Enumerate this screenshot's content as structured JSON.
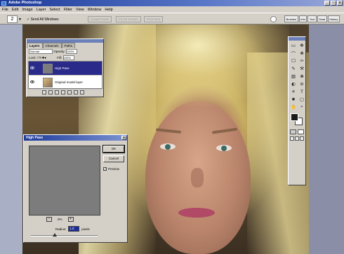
{
  "window": {
    "title": "Adobe Photoshop",
    "controls": [
      "_",
      "□",
      "x"
    ]
  },
  "menubar": [
    "File",
    "Edit",
    "Image",
    "Layer",
    "Select",
    "Filter",
    "View",
    "Window",
    "Help"
  ],
  "options": {
    "tool_preset": "2",
    "auto_select_label": "✓ Send All Windows",
    "buttons": [
      "Actual Pixels",
      "Fit On Screen",
      "Print Size"
    ],
    "palette_tabs": [
      "Brushes",
      "Info",
      "Tool",
      "Swat",
      "History"
    ]
  },
  "layers_palette": {
    "tabs": [
      "Layers",
      "Channels",
      "Paths"
    ],
    "mode": "Normal",
    "opacity_label": "Opacity:",
    "opacity": "100%",
    "lock_label": "Lock:",
    "fill_label": "Fill:",
    "fill": "100%",
    "layers": [
      {
        "name": "High Pass",
        "selected": true
      },
      {
        "name": "Original model layer",
        "selected": false
      }
    ]
  },
  "high_pass": {
    "title": "High Pass",
    "ok_label": "OK",
    "cancel_label": "Cancel",
    "preview_label": "Preview",
    "preview_checked": true,
    "zoom": "0%",
    "zoom_minus": "−",
    "zoom_plus": "+",
    "radius_label": "Radius:",
    "radius_value": "1.0",
    "radius_unit": "pixels",
    "close_label": "x"
  },
  "toolbox": {
    "tools": [
      "▭",
      "✥",
      "⌒",
      "❀",
      "☐",
      "✑",
      "✎",
      "⚒",
      "▨",
      "❀",
      "◐",
      "⊘",
      "✳",
      "T",
      "✸",
      "▢",
      "✋",
      "⌕"
    ]
  },
  "colors": {
    "title_bar": "#1d3a9a",
    "selection": "#2a2a8a",
    "chrome": "#d4d0c8"
  }
}
